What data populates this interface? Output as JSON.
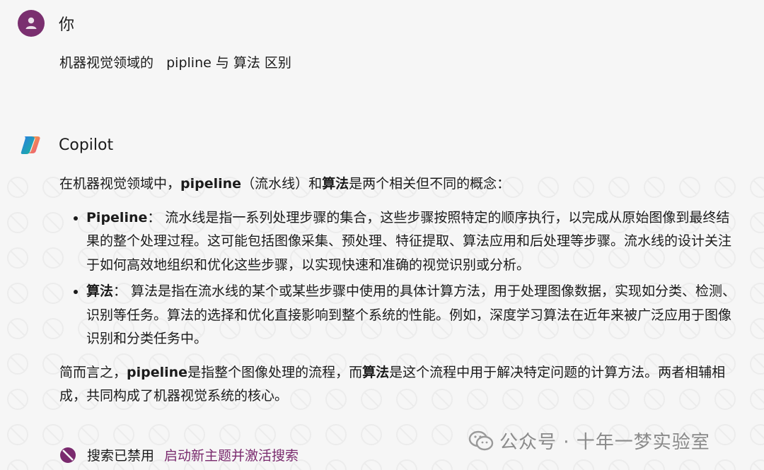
{
  "user": {
    "name": "你",
    "message": "机器视觉领域的   pipline 与 算法 区别"
  },
  "copilot": {
    "name": "Copilot",
    "intro": {
      "prefix": "在机器视觉领域中，",
      "term1": "pipeline",
      "mid": "（流水线）和",
      "term2": "算法",
      "suffix": "是两个相关但不同的概念："
    },
    "bullets": [
      {
        "term": "Pipeline",
        "text": "：  流水线是指一系列处理步骤的集合，这些步骤按照特定的顺序执行，以完成从原始图像到最终结果的整个处理过程。这可能包括图像采集、预处理、特征提取、算法应用和后处理等步骤。流水线的设计关注于如何高效地组织和优化这些步骤，以实现快速和准确的视觉识别或分析。"
      },
      {
        "term": "算法",
        "text": "：  算法是指在流水线的某个或某些步骤中使用的具体计算方法，用于处理图像数据，实现如分类、检测、识别等任务。算法的选择和优化直接影响到整个系统的性能。例如，深度学习算法在近年来被广泛应用于图像识别和分类任务中。"
      }
    ],
    "summary": {
      "prefix": "简而言之，",
      "term1": "pipeline",
      "mid": "是指整个图像处理的流程，而",
      "term2": "算法",
      "suffix": "是这个流程中用于解决特定问题的计算方法。两者相辅相成，共同构成了机器视觉系统的核心。"
    }
  },
  "search": {
    "disabled_label": "搜索已禁用",
    "enable_link": "启动新主题并激活搜索"
  },
  "watermark": {
    "text": "公众号 · 十年一梦实验室"
  },
  "colors": {
    "avatar_bg": "#7a2f6f",
    "link": "#7a2a6e",
    "background": "#f6f6f6"
  },
  "icons": {
    "user_avatar": "person-icon",
    "copilot_logo": "copilot-logo-icon",
    "search_disabled": "search-disabled-icon",
    "wechat": "wechat-icon"
  }
}
